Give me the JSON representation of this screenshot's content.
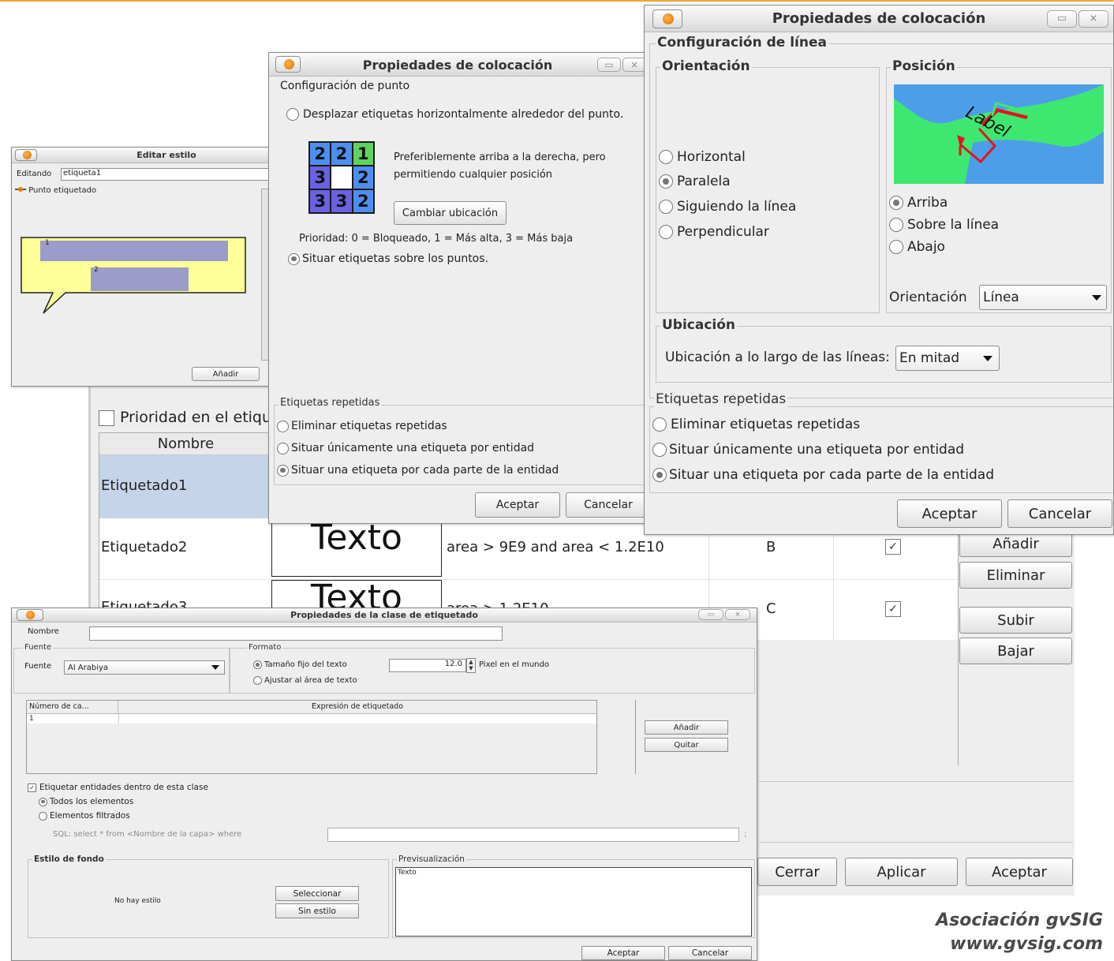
{
  "colors": {
    "accent_orange": "#f3a33b",
    "row_selected": "#c5d4e8",
    "map_water": "#4d9ee8",
    "map_land": "#3ee870",
    "map_line_red": "#e0161e",
    "grid_green": "#5fd35f",
    "grid_blue": "#4c8ff0",
    "grid_purple": "#6a61e3",
    "grid_white": "#ffffff",
    "balloon_yellow": "#ffff99",
    "balloon_label": "#9c9cc9"
  },
  "icons": {
    "app": "gvsig-orange-ball-icon",
    "minimize": "minimize-icon",
    "close": "close-icon",
    "dropdown": "chevron-down-icon",
    "spinner": "spinner-icon",
    "check": "checkmark-icon"
  },
  "brand": {
    "line1": "Asociación gvSIG",
    "line2": "www.gvsig.com"
  },
  "main": {
    "priority_label": "Prioridad en el etiqu",
    "col_nombre": "Nombre",
    "rows": [
      {
        "name": "Etiquetado1",
        "preview": "",
        "expr": "",
        "code": "",
        "checked": ""
      },
      {
        "name": "Etiquetado2",
        "preview": "Texto",
        "expr": "area > 9E9 and area < 1.2E10",
        "code": "B",
        "checked": "✓"
      },
      {
        "name": "Etiquetado3",
        "preview": "Texto",
        "expr": "area > 1.2E10",
        "code": "C",
        "checked": "✓"
      }
    ],
    "add": "Añadir",
    "remove": "Eliminar",
    "up": "Subir",
    "down": "Bajar",
    "close": "Cerrar",
    "apply": "Aplicar",
    "accept": "Aceptar"
  },
  "style_win": {
    "title": "Editar estilo",
    "editando_label": "Editando",
    "editando_value": "etiqueta1",
    "tree_item": "Punto etiquetado",
    "label1": "1",
    "label2": "2",
    "button": "Añadir"
  },
  "point_win": {
    "title": "Propiedades de colocación",
    "section": "Configuración de punto",
    "radio_offset": "Desplazar etiquetas horizontalmente alrededor del punto.",
    "grid": [
      "2",
      "2",
      "1",
      "3",
      "",
      "2",
      "3",
      "3",
      "2"
    ],
    "desc1": "Preferiblemente arriba a la derecha, pero",
    "desc2": "permitiendo cualquier posición",
    "change_btn": "Cambiar ubicación",
    "priority_text": "Prioridad: 0 = Bloqueado, 1 = Más alta, 3 = Más baja",
    "radio_on_points": "Situar etiquetas sobre los puntos.",
    "repeat_legend": "Etiquetas repetidas",
    "rep_remove": "Eliminar etiquetas repetidas",
    "rep_one": "Situar únicamente una etiqueta por entidad",
    "rep_each": "Situar una etiqueta por cada parte de la entidad",
    "accept": "Aceptar",
    "cancel": "Cancelar"
  },
  "line_win": {
    "title": "Propiedades de colocación",
    "section": "Configuración de línea",
    "orient_legend": "Orientación",
    "o_horizontal": "Horizontal",
    "o_parallel": "Paralela",
    "o_follow": "Siguiendo la línea",
    "o_perp": "Perpendicular",
    "pos_legend": "Posición",
    "map_label": "Label",
    "p_above": "Arriba",
    "p_on": "Sobre la línea",
    "p_below": "Abajo",
    "orient_combo_label": "Orientación",
    "orient_combo_value": "Línea",
    "ubic_legend": "Ubicación",
    "ubic_label": "Ubicación a lo largo de las líneas:",
    "ubic_value": "En mitad",
    "repeat_legend": "Etiquetas repetidas",
    "rep_remove": "Eliminar etiquetas repetidas",
    "rep_one": "Situar únicamente una etiqueta por entidad",
    "rep_each": "Situar una etiqueta por cada parte de la entidad",
    "accept": "Aceptar",
    "cancel": "Cancelar"
  },
  "class_win": {
    "title": "Propiedades de la clase de etiquetado",
    "name_label": "Nombre",
    "font_legend": "Fuente",
    "font_label": "Fuente",
    "font_value": "Al Arabiya",
    "format_legend": "Formato",
    "fixed_size": "Tamaño fijo del texto",
    "size_value": "12.0",
    "world_px": "Pixel en el mundo",
    "fit_area": "Ajustar al área de texto",
    "col_num": "Número de ca...",
    "col_expr": "Expresión de etiquetado",
    "row_num": "1",
    "add": "Añadir",
    "remove": "Quitar",
    "label_entities": "Etiquetar entidades dentro de esta clase",
    "all_elements": "Todos los elementos",
    "filtered": "Elementos filtrados",
    "sql": "SQL: select * from <Nombre de la capa> where",
    "sql_end": ";",
    "bg_legend": "Estilo de fondo",
    "bg_none": "No hay estilo",
    "select": "Seleccionar",
    "no_style": "Sin estilo",
    "preview_legend": "Previsualización",
    "preview_text": "Texto",
    "accept": "Aceptar",
    "cancel": "Cancelar"
  }
}
